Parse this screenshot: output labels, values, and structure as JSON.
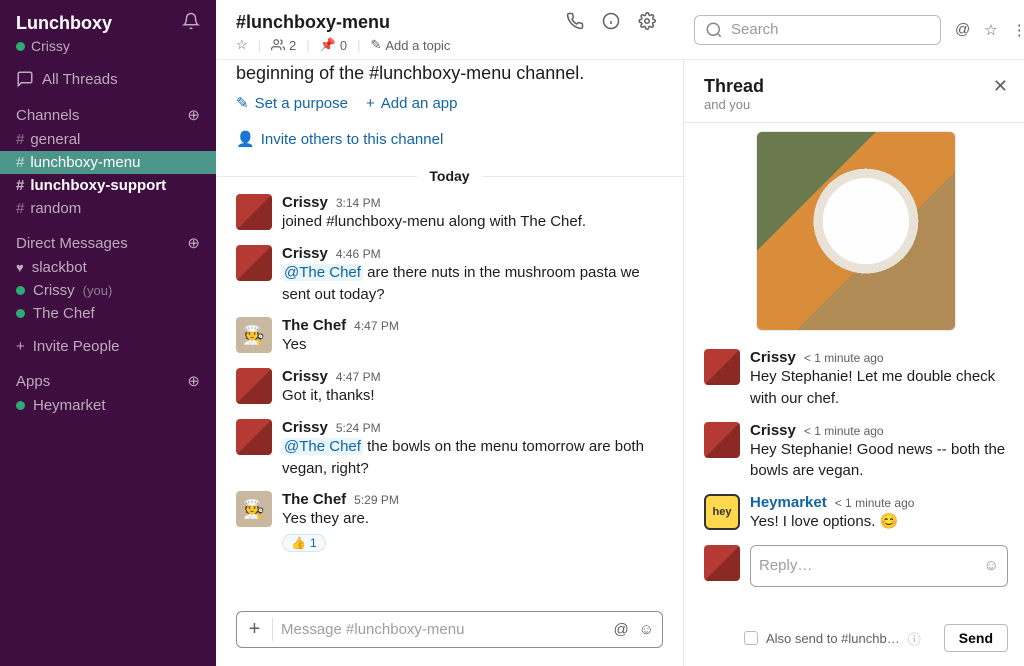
{
  "workspace": {
    "name": "Lunchboxy",
    "user": "Crissy"
  },
  "sidebar": {
    "allThreads": "All Threads",
    "channelsLabel": "Channels",
    "channels": [
      {
        "name": "general"
      },
      {
        "name": "lunchboxy-menu"
      },
      {
        "name": "lunchboxy-support"
      },
      {
        "name": "random"
      }
    ],
    "dmLabel": "Direct Messages",
    "dms": [
      {
        "name": "slackbot",
        "heart": true
      },
      {
        "name": "Crissy",
        "you": "(you)"
      },
      {
        "name": "The Chef"
      }
    ],
    "invite": "Invite People",
    "appsLabel": "Apps",
    "apps": [
      {
        "name": "Heymarket"
      }
    ]
  },
  "channelHeader": {
    "title": "#lunchboxy-menu",
    "members": "2",
    "pins": "0",
    "addTopic": "Add a topic"
  },
  "search": {
    "placeholder": "Search"
  },
  "intro": {
    "text1": "beginning of the ",
    "chname": "#lunchboxy-menu",
    "text2": " channel.",
    "links": {
      "purpose": "Set a purpose",
      "addApp": "Add an app",
      "invite": "Invite others to this channel"
    }
  },
  "dayDivider": "Today",
  "messages": [
    {
      "author": "Crissy",
      "time": "3:14 PM",
      "avatar": "crissy",
      "text": "joined #lunchboxy-menu along with The Chef."
    },
    {
      "author": "Crissy",
      "time": "4:46 PM",
      "avatar": "crissy",
      "textParts": [
        "@The Chef",
        " are there nuts in the mushroom pasta we sent out today?"
      ]
    },
    {
      "author": "The Chef",
      "time": "4:47 PM",
      "avatar": "chef",
      "text": "Yes"
    },
    {
      "author": "Crissy",
      "time": "4:47 PM",
      "avatar": "crissy",
      "text": "Got it, thanks!"
    },
    {
      "author": "Crissy",
      "time": "5:24 PM",
      "avatar": "crissy",
      "textParts": [
        "@The Chef",
        " the bowls on the menu tomorrow are both vegan, right?"
      ]
    },
    {
      "author": "The Chef",
      "time": "5:29 PM",
      "avatar": "chef",
      "text": "Yes they are.",
      "reaction": {
        "emoji": "👍",
        "count": "1"
      }
    }
  ],
  "composer": {
    "placeholder": "Message #lunchboxy-menu"
  },
  "thread": {
    "title": "Thread",
    "sub": "and you",
    "messages": [
      {
        "author": "Crissy",
        "time": "< 1 minute ago",
        "avatar": "crissy",
        "text": "Hey Stephanie!  Let me double check with our chef."
      },
      {
        "author": "Crissy",
        "time": "< 1 minute ago",
        "avatar": "crissy",
        "text": "Hey Stephanie!  Good news -- both the bowls are vegan."
      },
      {
        "author": "Heymarket",
        "time": "< 1 minute ago",
        "avatar": "hey",
        "app": true,
        "text": "Yes!  I love options. 😊"
      }
    ],
    "replyPlaceholder": "Reply…",
    "alsoSend": "Also send to #lunchb…",
    "sendLabel": "Send"
  }
}
